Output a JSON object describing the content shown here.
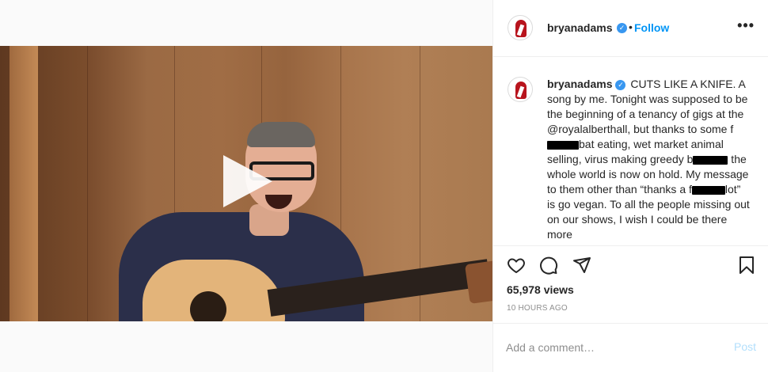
{
  "post": {
    "username": "bryanadams",
    "verified_icon": "verified-badge-icon",
    "separator": "•",
    "follow_label": "Follow",
    "more_icon": "more-options-icon",
    "more_glyph": "•••"
  },
  "caption": {
    "username": "bryanadams",
    "segments": [
      "CUTS LIKE A KNIFE. A song by me. Tonight was supposed to be the beginning of a tenancy of gigs at the @royalalberthall, but thanks to some f",
      "bat eating, wet market animal selling, virus making greedy b",
      " the whole world is now on hold. My message to them other than “thanks a f",
      "lot” is go vegan. To all the people missing out on our shows, I wish I could be there more"
    ]
  },
  "stats": {
    "views": "65,978 views",
    "time": "10 HOURS AGO"
  },
  "comment": {
    "placeholder": "Add a comment…",
    "post_label": "Post"
  },
  "icons": {
    "like": "heart-icon",
    "comment": "comment-icon",
    "share": "share-icon",
    "save": "bookmark-icon",
    "play": "play-icon"
  },
  "colors": {
    "accent": "#0095f6",
    "verified": "#3897f0",
    "post_disabled": "#b2dffc",
    "muted": "#8e8e8e",
    "text": "#262626"
  }
}
